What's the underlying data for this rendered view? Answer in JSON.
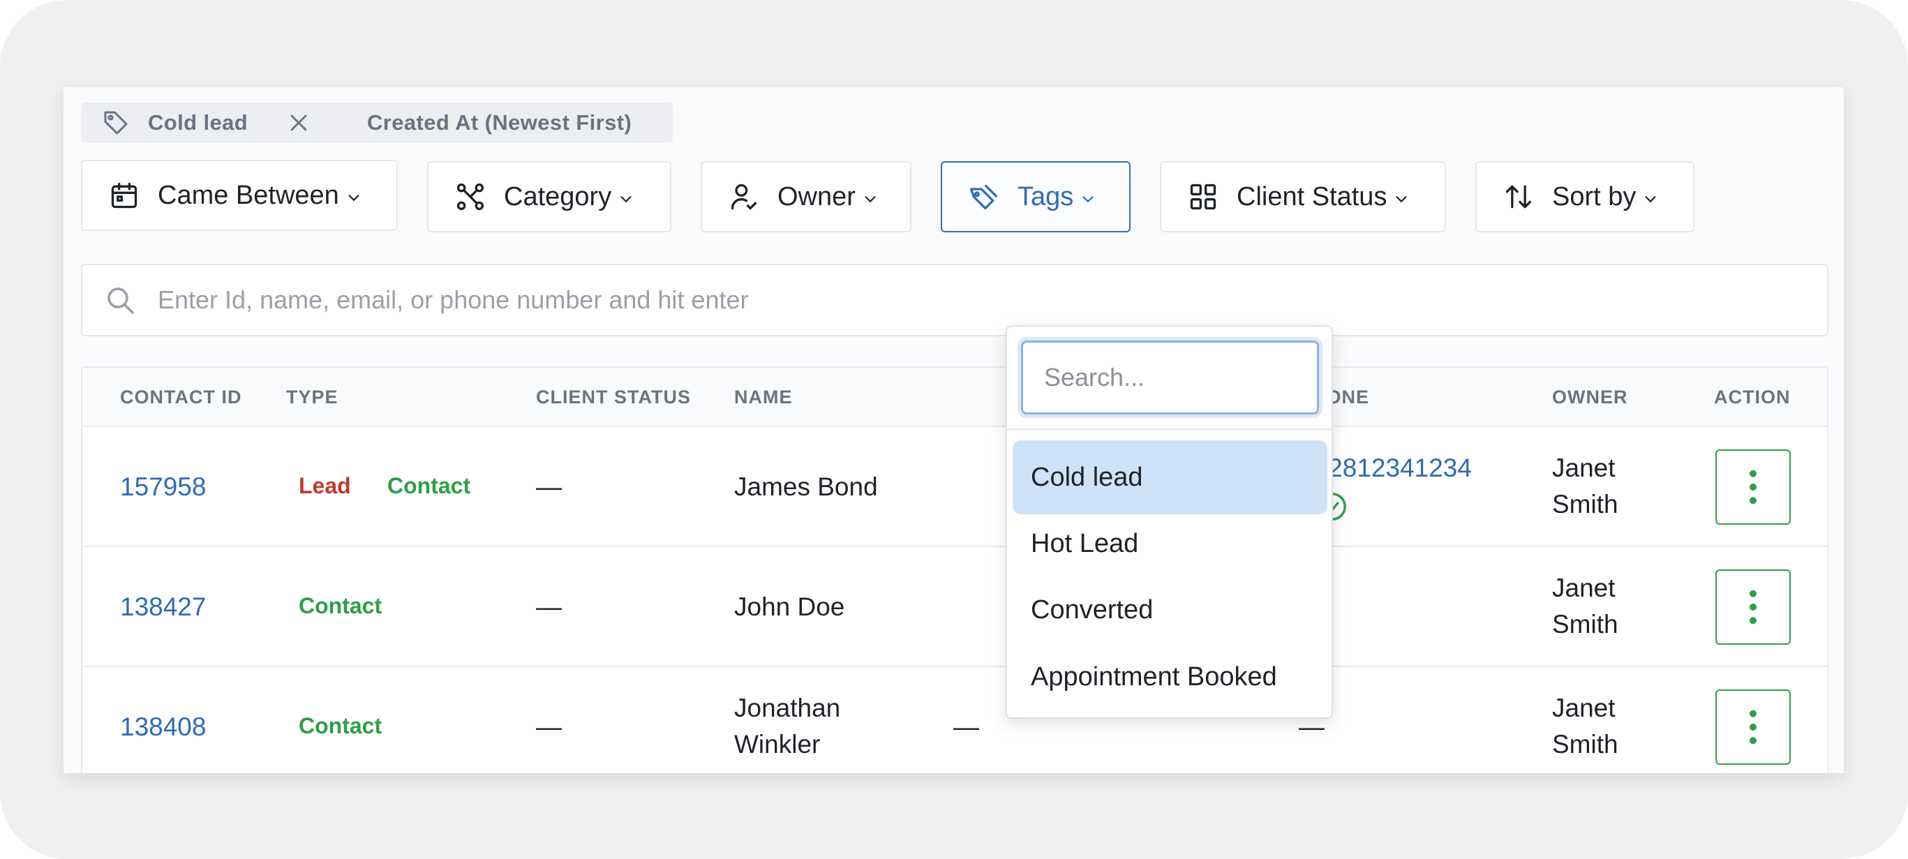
{
  "active_chips": [
    {
      "label": "Cold lead",
      "icon": "tag-icon",
      "removable": true
    },
    {
      "label": "Created At (Newest First)"
    }
  ],
  "filters": [
    {
      "label": "Came Between",
      "icon": "calendar-icon"
    },
    {
      "label": "Category",
      "icon": "category-icon"
    },
    {
      "label": "Owner",
      "icon": "user-check-icon"
    },
    {
      "label": "Tags",
      "icon": "tags-icon",
      "active": true
    },
    {
      "label": "Client Status",
      "icon": "grid-icon"
    },
    {
      "label": "Sort by",
      "icon": "sort-icon"
    }
  ],
  "search": {
    "placeholder": "Enter Id, name, email, or phone number and hit enter"
  },
  "table": {
    "columns": [
      "CONTACT ID",
      "TYPE",
      "CLIENT STATUS",
      "NAME",
      "PHONE",
      "OWNER",
      "ACTION"
    ],
    "rows": [
      {
        "id": "157958",
        "types": [
          "Lead",
          "Contact"
        ],
        "client_status": "—",
        "name": "James Bond",
        "email": "",
        "phone": "+12812341234",
        "phone_verified": true,
        "owner_first": "Janet",
        "owner_last": "Smith"
      },
      {
        "id": "138427",
        "types": [
          "Contact"
        ],
        "client_status": "—",
        "name": "John Doe",
        "email": "",
        "phone": "—",
        "owner_first": "Janet",
        "owner_last": "Smith"
      },
      {
        "id": "138408",
        "types": [
          "Contact"
        ],
        "client_status": "—",
        "name_first": "Jonathan",
        "name_last": "Winkler",
        "email": "—",
        "phone": "—",
        "owner_first": "Janet",
        "owner_last": "Smith"
      }
    ]
  },
  "tags_dropdown": {
    "search_placeholder": "Search...",
    "options": [
      "Cold lead",
      "Hot Lead",
      "Converted",
      "Appointment Booked"
    ],
    "selected": "Cold lead"
  },
  "colors": {
    "link": "#2f6bb3",
    "lead": "#c0392b",
    "contact": "#2e9f46",
    "selected_option": "#cfe3f8"
  }
}
